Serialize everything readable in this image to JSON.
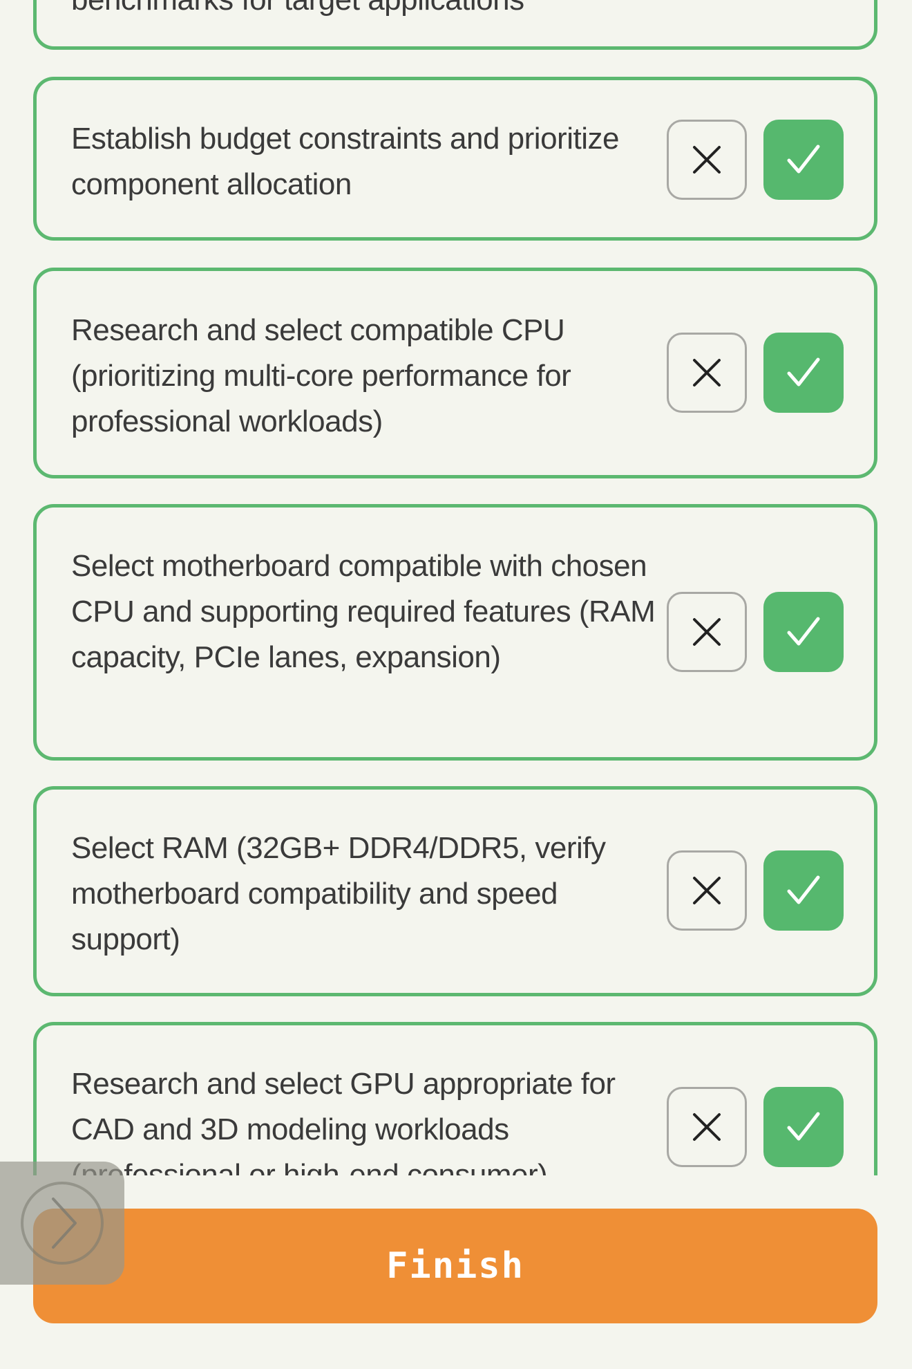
{
  "tasks": [
    {
      "text": "benchmarks for target applications"
    },
    {
      "text": "Establish budget constraints and prioritize component allocation"
    },
    {
      "text": "Research and select compatible CPU (prioritizing multi-core performance for professional workloads)"
    },
    {
      "text": "Select motherboard compatible with chosen CPU and supporting required features (RAM capacity, PCIe lanes, expansion)"
    },
    {
      "text": "Select RAM (32GB+ DDR4/DDR5, verify motherboard compatibility and speed support)"
    },
    {
      "text": "Research and select GPU appropriate for CAD and 3D modeling workloads (professional or high-end consumer)"
    }
  ],
  "icons": {
    "reject": "close-icon",
    "accept": "check-icon",
    "handle": "chevron-right-icon"
  },
  "colors": {
    "accent": "#5cb870",
    "accept": "#56b86e",
    "finish": "#ef8f36",
    "background": "#f4f5ee"
  },
  "footer": {
    "finish_label": "Finish"
  }
}
